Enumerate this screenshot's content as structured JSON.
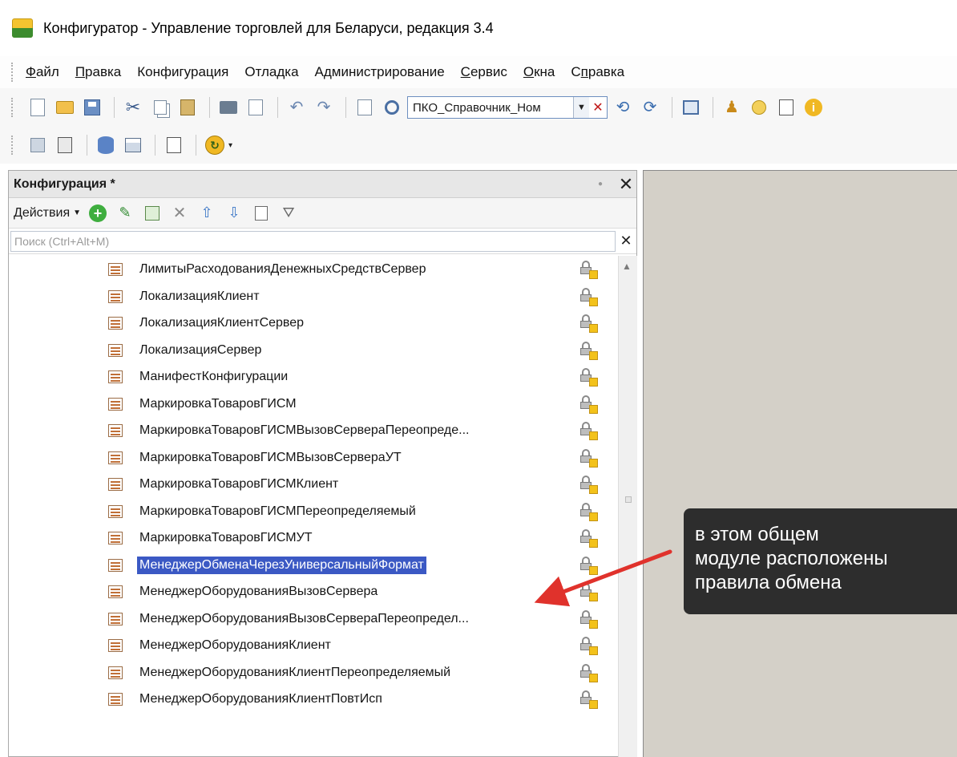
{
  "window": {
    "title": "Конфигуратор - Управление торговлей для Беларуси, редакция 3.4"
  },
  "menu": [
    {
      "label": "Файл"
    },
    {
      "label": "Правка"
    },
    {
      "label": "Конфигурация"
    },
    {
      "label": "Отладка"
    },
    {
      "label": "Администрирование"
    },
    {
      "label": "Сервис"
    },
    {
      "label": "Окна"
    },
    {
      "label": "Справка"
    }
  ],
  "toolbar": {
    "search_value": "ПКО_Справочник_Ном"
  },
  "panel": {
    "title": "Конфигурация *",
    "actions_label": "Действия",
    "search_placeholder": "Поиск (Ctrl+Alt+M)"
  },
  "tree": {
    "items": [
      {
        "label": "ЛимитыРасходованияДенежныхСредствСервер"
      },
      {
        "label": "ЛокализацияКлиент"
      },
      {
        "label": "ЛокализацияКлиентСервер"
      },
      {
        "label": "ЛокализацияСервер"
      },
      {
        "label": "МанифестКонфигурации"
      },
      {
        "label": "МаркировкаТоваровГИСМ"
      },
      {
        "label": "МаркировкаТоваровГИСМВызовСервераПереопреде..."
      },
      {
        "label": "МаркировкаТоваровГИСМВызовСервераУТ"
      },
      {
        "label": "МаркировкаТоваровГИСМКлиент"
      },
      {
        "label": "МаркировкаТоваровГИСМПереопределяемый"
      },
      {
        "label": "МаркировкаТоваровГИСМУТ"
      },
      {
        "label": "МенеджерОбменаЧерезУниверсальныйФормат",
        "selected": true
      },
      {
        "label": "МенеджерОборудованияВызовСервера"
      },
      {
        "label": "МенеджерОборудованияВызовСервераПереопредел..."
      },
      {
        "label": "МенеджерОборудованияКлиент"
      },
      {
        "label": "МенеджерОборудованияКлиентПереопределяемый"
      },
      {
        "label": "МенеджерОборудованияКлиентПовтИсп"
      }
    ]
  },
  "callout": {
    "line1": "в этом общем",
    "line2": "модуле расположены",
    "line3": "правила обмена"
  },
  "colors": {
    "selection": "#3b59c4",
    "arrow": "#e0322c",
    "callout_bg": "#2d2d2d",
    "workspace": "#d4d0c8"
  }
}
